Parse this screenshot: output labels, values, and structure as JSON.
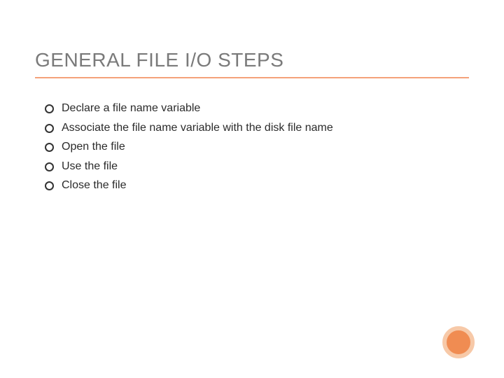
{
  "slide": {
    "title": "GENERAL FILE I/O STEPS",
    "bullets": [
      "Declare a file name variable",
      " Associate the file name variable with the     disk file name",
      " Open the file",
      " Use the file",
      " Close the file"
    ],
    "accent_color": "#f4a27a",
    "circle_fill": "#f08c52",
    "circle_ring": "#f7c9a8"
  }
}
